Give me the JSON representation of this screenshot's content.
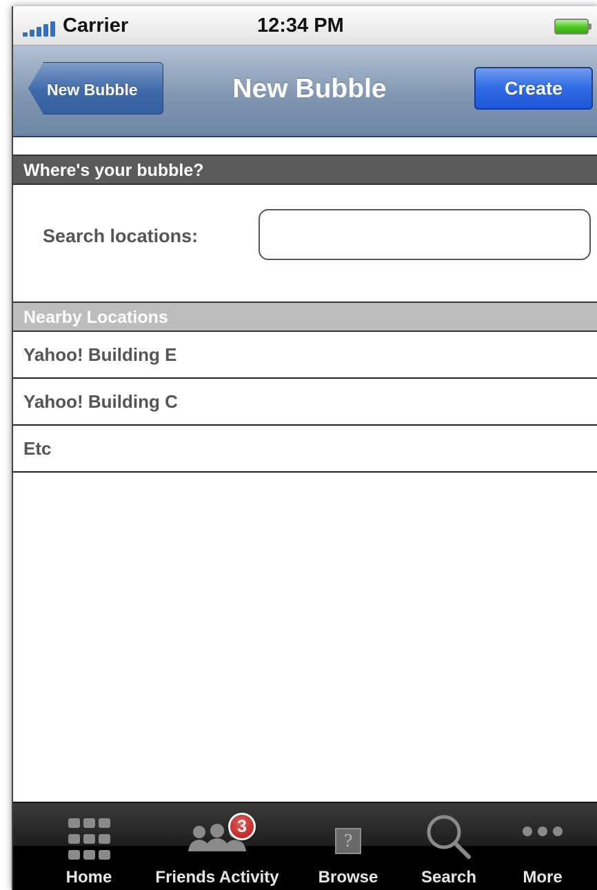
{
  "status_bar": {
    "carrier": "Carrier",
    "time": "12:34 PM",
    "signal_icon": "signal-bars-icon",
    "battery_icon": "battery-icon",
    "battery_color": "#4bc61f",
    "signal_color": "#2f6fc4"
  },
  "nav_bar": {
    "back_label": "New Bubble",
    "title": "New Bubble",
    "create_label": "Create",
    "create_color": "#2f6ae3"
  },
  "location_section": {
    "header": "Where's your bubble?",
    "search_label": "Search locations:",
    "search_value": "",
    "search_placeholder": ""
  },
  "nearby_section": {
    "header": "Nearby Locations",
    "items": [
      {
        "label": "Yahoo! Building E"
      },
      {
        "label": "Yahoo! Building C"
      },
      {
        "label": "Etc"
      }
    ]
  },
  "tab_bar": {
    "tabs": [
      {
        "label": "Home",
        "icon": "home-grid-icon"
      },
      {
        "label": "Friends Activity",
        "icon": "friends-icon",
        "badge": "3"
      },
      {
        "label": "Browse",
        "icon": "browse-icon",
        "glyph": "?"
      },
      {
        "label": "Search",
        "icon": "search-icon"
      },
      {
        "label": "More",
        "icon": "more-icon"
      }
    ],
    "badge_color": "#b31818"
  }
}
